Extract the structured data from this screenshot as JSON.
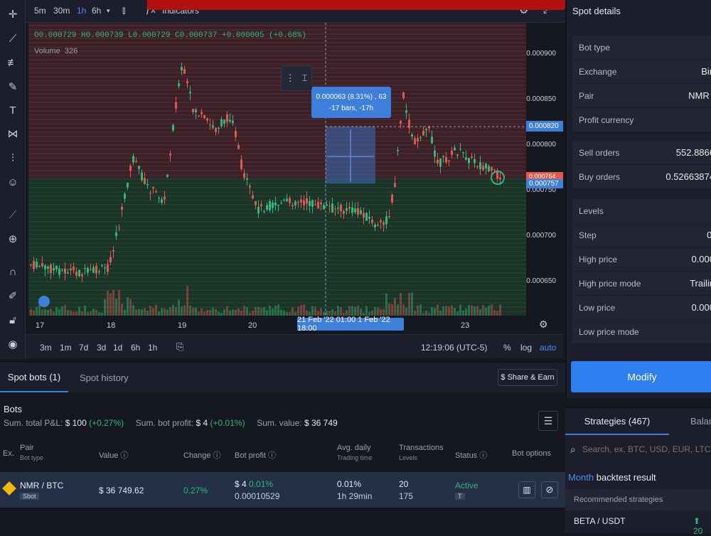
{
  "top": {
    "timeframes": [
      "5m",
      "30m",
      "1h",
      "6h"
    ],
    "active_timeframe": "1h",
    "indicators_label": "Indicators"
  },
  "chart": {
    "ohlc_line": "O0.000729 H0.000739 L0.000729 C0.000737 +0.000005 (+0.68%)",
    "volume_label": "Volume",
    "volume_value": "326",
    "y_ticks": [
      "0.000900",
      "0.000850",
      "0.000800",
      "0.000750",
      "0.000700",
      "0.000650"
    ],
    "y_marker_upper": "0.000820",
    "y_marker_mid": "0.000764",
    "y_marker_lower": "0.000757",
    "tooltip_line1": "0.000063 (8.31%) , 63",
    "tooltip_line2": "-17 bars, -17h",
    "x_ticks": [
      "17",
      "18",
      "19",
      "20",
      "23"
    ],
    "x_highlight": "21 Feb '22   01:00  1 Feb '22   18:00",
    "colors": {
      "up": "#2fb97a",
      "down": "#e0594f",
      "accent": "#3d7fdb"
    }
  },
  "rangebar": {
    "ranges": [
      "3m",
      "1m",
      "7d",
      "3d",
      "1d",
      "6h",
      "1h"
    ],
    "clock": "12:19:06 (UTC-5)",
    "pct": "%",
    "log": "log",
    "auto": "auto"
  },
  "spot_details": {
    "title": "Spot details",
    "rows": [
      {
        "label": "Bot type",
        "value": ""
      },
      {
        "label": "Exchange",
        "value": "Bin"
      },
      {
        "label": "Pair",
        "value": "NMR /"
      },
      {
        "label": "Profit currency",
        "value": ""
      },
      {
        "label": "Sell orders",
        "value": "552.8866"
      },
      {
        "label": "Buy orders",
        "value": "0.52663874"
      },
      {
        "label": "Levels",
        "value": ""
      },
      {
        "label": "Step",
        "value": "0."
      },
      {
        "label": "High price",
        "value": "0.000"
      },
      {
        "label": "High price mode",
        "value": "Trailin"
      },
      {
        "label": "Low price",
        "value": "0.000"
      },
      {
        "label": "Low price mode",
        "value": ""
      }
    ],
    "modify_label": "Modify"
  },
  "tabs": {
    "spot_bots": "Spot bots (1)",
    "spot_history": "Spot history",
    "share_earn": "$ Share & Earn"
  },
  "bots": {
    "title": "Bots",
    "sum_pl_label": "Sum. total P&L:",
    "sum_pl_value": "$ 100",
    "sum_pl_pct": "(+0.27%)",
    "sum_profit_label": "Sum. bot profit:",
    "sum_profit_value": "$ 4",
    "sum_profit_pct": "(+0.01%)",
    "sum_value_label": "Sum. value:",
    "sum_value_value": "$ 36 749",
    "headers": {
      "ex": "Ex.",
      "pair": "Pair",
      "pair_sub": "Bot type",
      "value": "Value",
      "change": "Change",
      "bot_profit": "Bot profit",
      "avg_daily": "Avg. daily",
      "avg_daily_sub": "Trading time",
      "transactions": "Transactions",
      "transactions_sub": "Levels",
      "status": "Status",
      "bot_options": "Bot options"
    },
    "row": {
      "pair": "NMR / BTC",
      "type": "Sbot",
      "value": "$ 36 749.62",
      "change": "0.27%",
      "profit_usd": "$ 4",
      "profit_pct": "0.01%",
      "profit_btc": "0.00010529",
      "avg_daily": "0.01%",
      "trading_time": "1h 29min",
      "transactions": "20",
      "levels": "175",
      "status": "Active",
      "status_sub": "T"
    }
  },
  "strategies": {
    "tab": "Strategies (467)",
    "tab2": "Balan",
    "search_placeholder": "Search, ex. BTC, USD, EUR, LTC",
    "backtest_month": "Month",
    "backtest_rest": "backtest result",
    "recommended": "Recommended strategies",
    "first_pair": "BETA / USDT",
    "first_value": "20"
  }
}
